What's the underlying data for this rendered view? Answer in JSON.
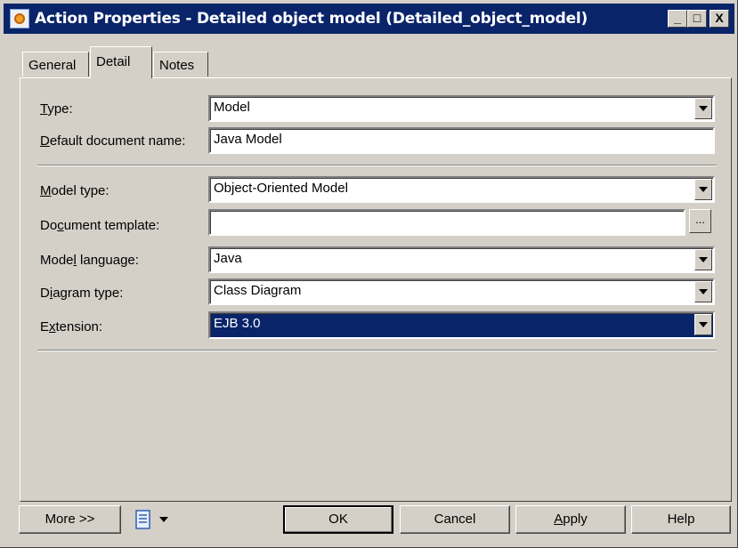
{
  "window": {
    "title": "Action Properties - Detailed object model (Detailed_object_model)",
    "minimize_glyph": "_",
    "maximize_glyph": "□",
    "close_glyph": "X"
  },
  "tabs": [
    {
      "label": "General",
      "active": false
    },
    {
      "label": "Detail",
      "active": true
    },
    {
      "label": "Notes",
      "active": false
    }
  ],
  "form": {
    "type": {
      "label_prefix": "",
      "label_key": "T",
      "label_rest": "ype:",
      "value": "Model"
    },
    "default_doc": {
      "label_prefix": "",
      "label_key": "D",
      "label_rest": "efault document name:",
      "value": "Java Model"
    },
    "model_type": {
      "label_prefix": "",
      "label_key": "M",
      "label_rest": "odel type:",
      "value": "Object-Oriented Model"
    },
    "doc_template": {
      "label_prefix": "Do",
      "label_key": "c",
      "label_rest": "ument template:",
      "value": "",
      "button": "..."
    },
    "model_language": {
      "label_prefix": "Mode",
      "label_key": "l",
      "label_rest": " language:",
      "value": "Java"
    },
    "diagram_type": {
      "label_prefix": "D",
      "label_key": "i",
      "label_rest": "agram type:",
      "value": "Class Diagram"
    },
    "extension": {
      "label_prefix": "E",
      "label_key": "x",
      "label_rest": "tension:",
      "value": "EJB 3.0"
    }
  },
  "footer": {
    "more": "More >>",
    "ok": "OK",
    "cancel": "Cancel",
    "apply_key": "A",
    "apply_rest": "pply",
    "help": "Help",
    "icon": "print-menu-icon"
  },
  "colors": {
    "titlebar": "#0a246a",
    "dialog": "#d4d0c8",
    "selection": "#0a246a"
  }
}
